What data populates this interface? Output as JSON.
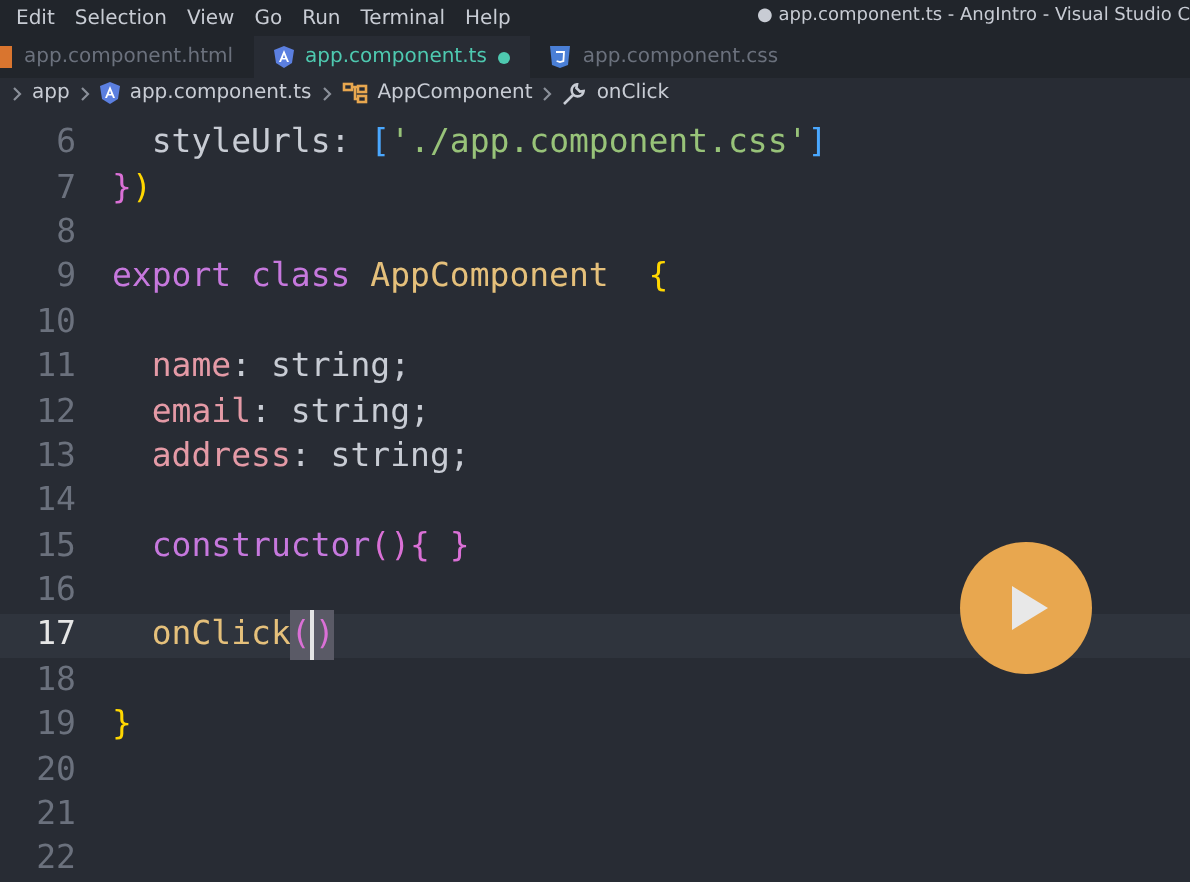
{
  "menu_bar": {
    "items": [
      "Edit",
      "Selection",
      "View",
      "Go",
      "Run",
      "Terminal",
      "Help"
    ],
    "title": "● app.component.ts - AngIntro - Visual Studio C"
  },
  "tabs": [
    {
      "label": "app.component.html",
      "kind": "html",
      "selected": false,
      "modified": false
    },
    {
      "label": "app.component.ts",
      "kind": "angular",
      "selected": true,
      "modified": true
    },
    {
      "label": "app.component.css",
      "kind": "css",
      "selected": false,
      "modified": false
    }
  ],
  "breadcrumb": [
    {
      "label": "app",
      "kind": "folder"
    },
    {
      "label": "app.component.ts",
      "kind": "angular"
    },
    {
      "label": "AppComponent",
      "kind": "class"
    },
    {
      "label": "onClick",
      "kind": "method"
    }
  ],
  "editor": {
    "lines": [
      {
        "number": "6",
        "current": false,
        "tokens": [
          {
            "text": "  styleUrls",
            "kind": "text"
          },
          {
            "text": ": ",
            "kind": "text"
          },
          {
            "text": "[",
            "kind": "bracket-blue"
          },
          {
            "text": "'./app.component.css'",
            "kind": "string"
          },
          {
            "text": "]",
            "kind": "bracket-blue"
          }
        ]
      },
      {
        "number": "7",
        "current": false,
        "tokens": [
          {
            "text": "}",
            "kind": "bracket-purple"
          },
          {
            "text": ")",
            "kind": "bracket-yellow"
          }
        ]
      },
      {
        "number": "8",
        "current": false
      },
      {
        "number": "9",
        "current": false,
        "tokens": [
          {
            "text": "export ",
            "kind": "keyword"
          },
          {
            "text": "class ",
            "kind": "keyword"
          },
          {
            "text": "AppComponent",
            "kind": "class"
          },
          {
            "text": "  {",
            "kind": "bracket-yellow"
          }
        ]
      },
      {
        "number": "10",
        "current": false
      },
      {
        "number": "11",
        "current": false,
        "tokens": [
          {
            "text": "  name",
            "kind": "property"
          },
          {
            "text": ": string;",
            "kind": "text"
          }
        ]
      },
      {
        "number": "12",
        "current": false,
        "tokens": [
          {
            "text": "  email",
            "kind": "property"
          },
          {
            "text": ": string;",
            "kind": "text"
          }
        ]
      },
      {
        "number": "13",
        "current": false,
        "tokens": [
          {
            "text": "  address",
            "kind": "property"
          },
          {
            "text": ": string;",
            "kind": "text"
          }
        ]
      },
      {
        "number": "14",
        "current": false
      },
      {
        "number": "15",
        "current": false,
        "tokens": [
          {
            "text": "  constructor",
            "kind": "keyword"
          },
          {
            "text": "()",
            "kind": "bracket-purple"
          },
          {
            "text": "{ }",
            "kind": "bracket-purple"
          }
        ]
      },
      {
        "number": "16",
        "current": false
      },
      {
        "number": "17",
        "current": true,
        "tokens": [
          {
            "text": "  onClick",
            "kind": "class"
          },
          {
            "text": "(",
            "kind": "bracket-match"
          },
          {
            "text": ")",
            "kind": "bracket-match",
            "cursor_before": true
          }
        ]
      },
      {
        "number": "18",
        "current": false
      },
      {
        "number": "19",
        "current": false,
        "tokens": [
          {
            "text": "}",
            "kind": "bracket-yellow"
          }
        ]
      },
      {
        "number": "20",
        "current": false
      },
      {
        "number": "21",
        "current": false
      },
      {
        "number": "22",
        "current": false
      }
    ]
  }
}
